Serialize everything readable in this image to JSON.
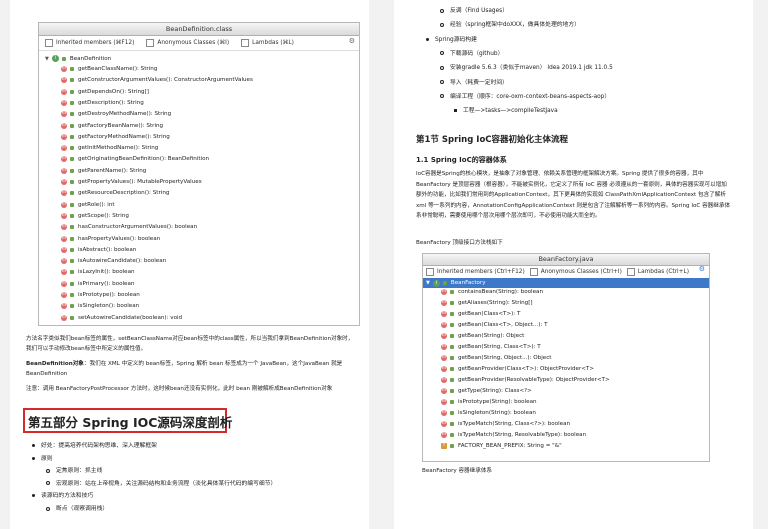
{
  "left_page": {
    "bd_window": {
      "title": "BeanDefinition.class",
      "options": [
        "Inherited members (⌘F12)",
        "Anonymous Classes (⌘I)",
        "Lambdas (⌘L)"
      ],
      "root": "BeanDefinition",
      "methods": [
        "getBeanClassName(): String",
        "getConstructorArgumentValues(): ConstructorArgumentValues",
        "getDependsOn(): String[]",
        "getDescription(): String",
        "getDestroyMethodName(): String",
        "getFactoryBeanName(): String",
        "getFactoryMethodName(): String",
        "getInitMethodName(): String",
        "getOriginatingBeanDefinition(): BeanDefinition",
        "getParentName(): String",
        "getPropertyValues(): MutablePropertyValues",
        "getResourceDescription(): String",
        "getRole(): int",
        "getScope(): String",
        "hasConstructorArgumentValues(): boolean",
        "hasPropertyValues(): boolean",
        "isAbstract(): boolean",
        "isAutowireCandidate(): boolean",
        "isLazyInit(): boolean",
        "isPrimary(): boolean",
        "isPrototype(): boolean",
        "isSingleton(): boolean",
        "setAutowireCandidate(boolean): void"
      ]
    },
    "para1": "方法名字类似我们bean标签的属性，setBeanClassName对应bean标签中的class属性，所以当我们拿到BeanDefinition对象时，我们可以手动修改bean标签中所定义的属性值。",
    "para2_bold": "BeanDefinition对象",
    "para2": "：我们在 XML 中定义的 bean标签，Spring 解析 bean 标签成为一个 JavaBean，这个JavaBean 就是 BeanDefinition",
    "para3": "注意：调用 BeanFactoryPostProcessor 方法时，这时候bean还没有实例化，此时 bean 刚被解析成BeanDefinition对象",
    "part5_heading": "第五部分 Spring IOC源码深度剖析",
    "bullets": [
      {
        "level": 1,
        "text": "好处：提高培养代码架构思维、深入理解框架"
      },
      {
        "level": 1,
        "text": "原则"
      },
      {
        "level": 2,
        "text": "定焦原则：抓主线"
      },
      {
        "level": 2,
        "text": "宏观原则：站在上帝视角，关注源码结构和业务流程（淡化具体某行代码的编写细节）"
      },
      {
        "level": 1,
        "text": "读源码的方法和技巧"
      },
      {
        "level": 2,
        "text": "断点（观察调用栈）"
      }
    ]
  },
  "right_page": {
    "top_bullets": [
      {
        "level": 2,
        "text": "反调（Find Usages）"
      },
      {
        "level": 2,
        "text": "经验（spring框架中doXXX，做具体处理的地方）"
      },
      {
        "level": 1,
        "text": "Spring源码构建"
      },
      {
        "level": 2,
        "text": "下载源码（github）"
      },
      {
        "level": 2,
        "text": "安装gradle 5.6.3（类似于maven） Idea 2019.1 jdk 11.0.5"
      },
      {
        "level": 2,
        "text": "导入（耗费一定时间）"
      },
      {
        "level": 2,
        "text": "编译工程（顺序：core-oxm-context-beans-aspects-aop）"
      },
      {
        "level": 3,
        "text": "工程—>tasks—>compileTestJava"
      }
    ],
    "section_heading": "第1节 Spring IoC容器初始化主体流程",
    "subsection_heading": "1.1 Spring IoC的容器体系",
    "body": "IoC容器是Spring的核心模块，是抽象了对象管理、依赖关系管理的框架解决方案。Spring 提供了很多的容器，其中 BeanFactory 是顶层容器（根容器），不能被实例化，它定义了所有 IoC 容器 必须遵从的一套原则，具体的容器实现可以增加额外的功能，比如我们常用到的ApplicationContext，其下更具体的实现如 ClassPathXmlApplicationContext 包含了解析 xml 等一系列的内容，AnnotationConfigApplicationContext 则是包含了注解解析等一系列的内容。Spring IoC 容器继承体系非常聪明，需要使用哪个层次用哪个层次即可，不必使用功能大而全的。",
    "caption1": "BeanFactory 顶级接口方法栈如下",
    "bf_window": {
      "title": "BeanFactory.java",
      "options": [
        "Inherited members (Ctrl+F12)",
        "Anonymous Classes (Ctrl+I)",
        "Lambdas (Ctrl+L)"
      ],
      "root": "BeanFactory",
      "methods": [
        "containsBean(String): boolean",
        "getAliases(String): String[]",
        "getBean(Class<T>): T",
        "getBean(Class<T>, Object...): T",
        "getBean(String): Object",
        "getBean(String, Class<T>): T",
        "getBean(String, Object...): Object",
        "getBeanProvider(Class<T>): ObjectProvider<T>",
        "getBeanProvider(ResolvableType): ObjectProvider<T>",
        "getType(String): Class<?>",
        "isPrototype(String): boolean",
        "isSingleton(String): boolean",
        "isTypeMatch(String, Class<?>): boolean",
        "isTypeMatch(String, ResolvableType): boolean",
        "FACTORY_BEAN_PREFIX: String = \"&\""
      ]
    },
    "caption2": "BeanFactory 容器继承体系"
  },
  "colors": {
    "highlight_box": "#d42a2a",
    "selection": "#3d78c9",
    "method_icon": "#e06a6a"
  }
}
